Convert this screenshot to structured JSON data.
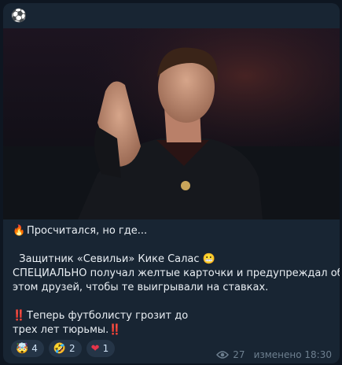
{
  "header": {
    "icon": "⚽"
  },
  "post": {
    "lines": [
      "Просчитался, но где...",
      "",
      "Защитник «Севильи» Кике Салас",
      "СПЕЦИАЛЬНО получал желтые карточки и предупреждал об",
      "этом друзей, чтобы те выигрывали на ставках.",
      "",
      "Теперь футболисту грозит до",
      "трех лет тюрьмы."
    ],
    "emoji": {
      "fire": "🔥",
      "grimace": "😬",
      "alarm": "‼️"
    }
  },
  "reactions": [
    {
      "icon": "mind-blown-icon",
      "emoji": "🤯",
      "count": "4"
    },
    {
      "icon": "rofl-icon",
      "emoji": "🤣",
      "count": "2"
    },
    {
      "icon": "heart-icon",
      "emoji": "❤",
      "count": "1"
    }
  ],
  "footer": {
    "views": "27",
    "edited": "изменено 18:30"
  }
}
